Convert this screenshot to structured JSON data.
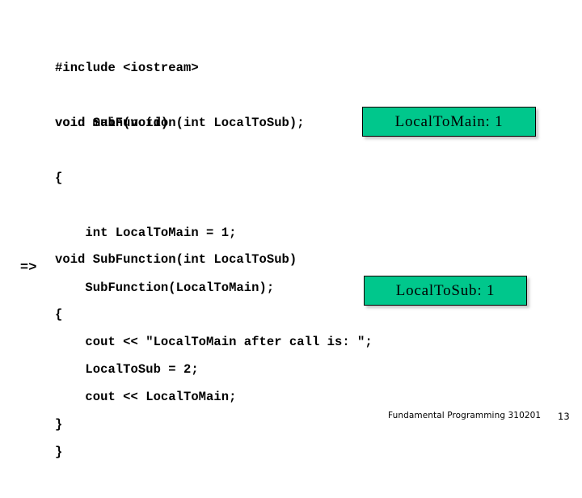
{
  "slide": {
    "background_color": "#ffffff",
    "code_blocks": [
      {
        "id": "block-1",
        "lines": [
          "#include <iostream>",
          "void SubFunction(int LocalToSub);"
        ]
      },
      {
        "id": "block-2",
        "lines": [
          "void main(void)",
          "{",
          "    int LocalToMain = 1;",
          "    SubFunction(LocalToMain);",
          "    cout << \"LocalToMain after call is: \";",
          "    cout << LocalToMain;",
          "}"
        ]
      },
      {
        "id": "block-3",
        "lines": [
          "void SubFunction(int LocalToSub)",
          "{",
          "    LocalToSub = 2;",
          "}"
        ]
      }
    ],
    "exec_marker": "=>",
    "callouts": [
      {
        "id": "callout-main",
        "label": "LocalToMain: 1",
        "fill_color": "#00C78C",
        "border_color": "#000000"
      },
      {
        "id": "callout-sub",
        "label": "LocalToSub: 1",
        "fill_color": "#00C78C",
        "border_color": "#000000"
      }
    ],
    "footer": {
      "course": "Fundamental Programming 310201",
      "page_number": "13"
    }
  }
}
